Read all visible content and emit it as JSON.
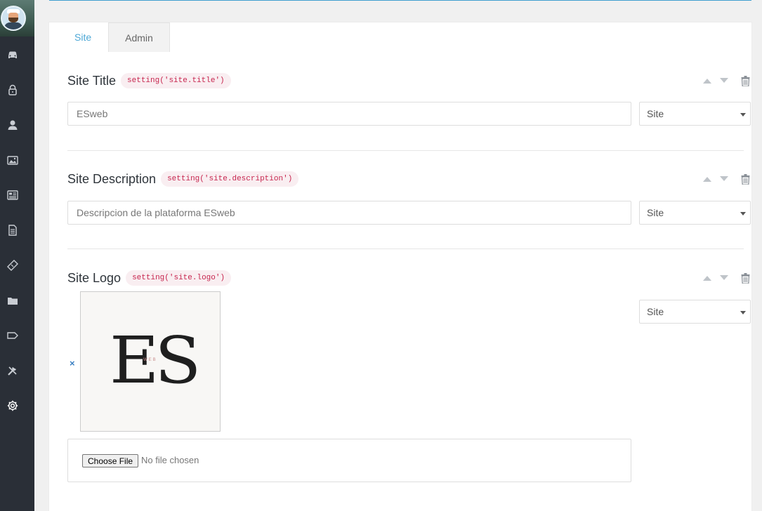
{
  "sidebar": {
    "icons": [
      "car-icon",
      "lock-icon",
      "user-icon",
      "images-icon",
      "newspaper-icon",
      "document-icon",
      "ticket-icon",
      "folder-icon",
      "tag-icon",
      "tools-icon",
      "gear-icon"
    ]
  },
  "tabs": [
    {
      "label": "Site",
      "active": true
    },
    {
      "label": "Admin",
      "active": false
    }
  ],
  "settings": {
    "title": {
      "name": "Site Title",
      "key": "setting('site.title')",
      "value": "ESweb",
      "group": "Site"
    },
    "description": {
      "name": "Site Description",
      "key": "setting('site.description')",
      "placeholder": "Descripcion de la plataforma ESweb",
      "group": "Site"
    },
    "logo": {
      "name": "Site Logo",
      "key": "setting('site.logo')",
      "remove_label": "×",
      "logo_letters": "ES",
      "logo_subtext": "WEB",
      "group": "Site",
      "file_button": "Choose File",
      "file_status": "No file chosen"
    }
  },
  "colors": {
    "accent": "#3f9fcf",
    "sidebar": "#2a2f37",
    "code": "#c7254e",
    "code_bg": "#f9eef1"
  }
}
